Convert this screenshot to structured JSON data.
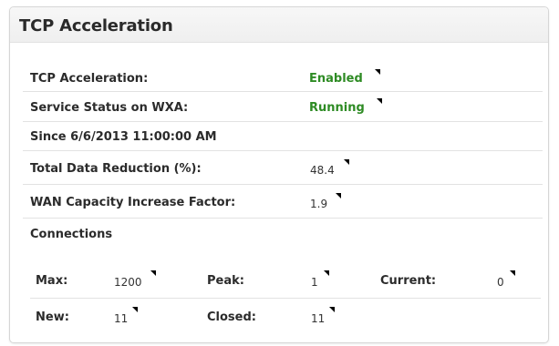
{
  "panel": {
    "title": "TCP Acceleration"
  },
  "rows": {
    "tcp_acceleration": {
      "label": "TCP Acceleration:",
      "value": "Enabled"
    },
    "service_status": {
      "label": "Service Status on WXA:",
      "value": "Running"
    },
    "since": {
      "label": "Since 6/6/2013 11:00:00 AM"
    },
    "total_data_reduction": {
      "label": "Total Data Reduction (%):",
      "value": "48.4"
    },
    "wan_capacity": {
      "label": "WAN Capacity Increase Factor:",
      "value": "1.9"
    },
    "connections": {
      "label": "Connections"
    }
  },
  "connections": {
    "max": {
      "label": "Max:",
      "value": "1200"
    },
    "peak": {
      "label": "Peak:",
      "value": "1"
    },
    "current": {
      "label": "Current:",
      "value": "0"
    },
    "new": {
      "label": "New:",
      "value": "11"
    },
    "closed": {
      "label": "Closed:",
      "value": "11"
    }
  },
  "colors": {
    "status_green": "#2e8b24",
    "header_bg": "#f3f3f3",
    "border": "#d6d6d6"
  },
  "icons": {
    "dropdown": "triangle-dropdown-icon"
  }
}
